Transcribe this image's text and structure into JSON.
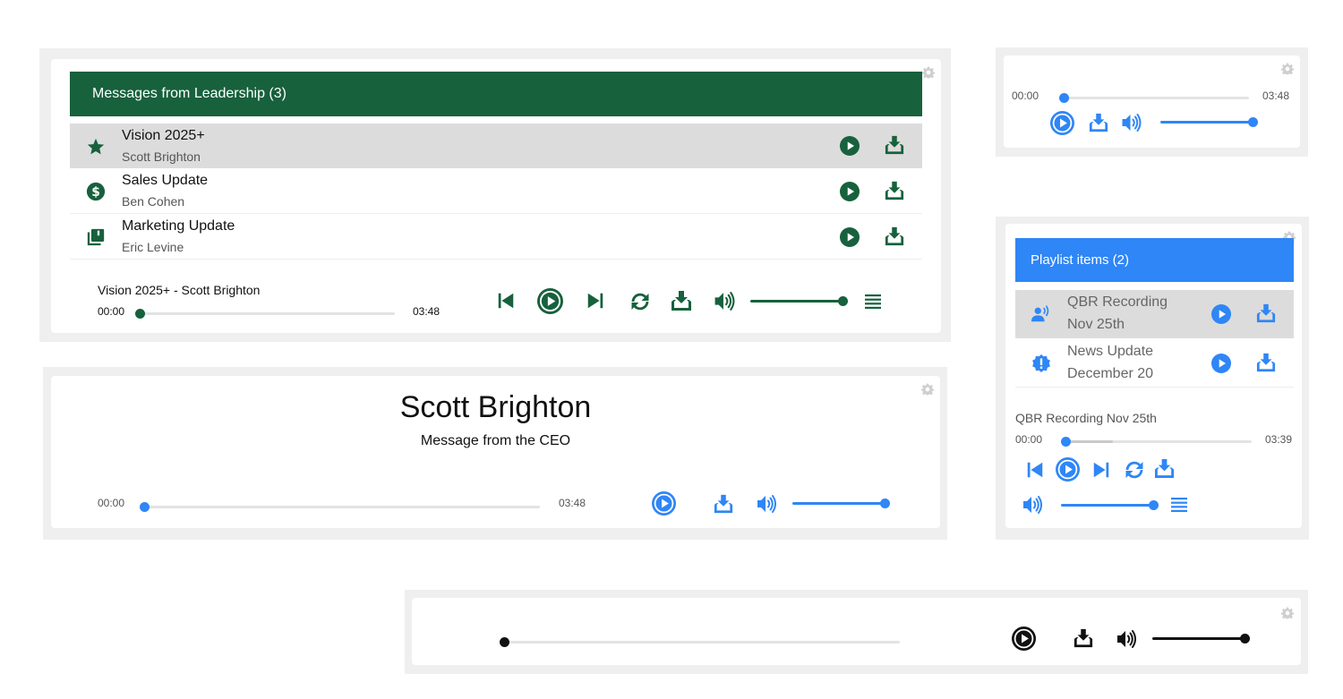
{
  "colors": {
    "green": "#17613d",
    "blue": "#2f86f6",
    "black": "#111111",
    "frame": "#efefef"
  },
  "leadership_player": {
    "header": "Messages from Leadership (3)",
    "items": [
      {
        "title": "Vision 2025+",
        "author": "Scott Brighton",
        "icon": "star-icon",
        "selected": true
      },
      {
        "title": "Sales Update",
        "author": "Ben Cohen",
        "icon": "dollar-icon",
        "selected": false
      },
      {
        "title": "Marketing Update",
        "author": "Eric Levine",
        "icon": "library-icon",
        "selected": false
      }
    ],
    "now_playing": "Vision 2025+ - Scott Brighton",
    "time_current": "00:00",
    "time_total": "03:48",
    "progress": 0,
    "volume": 1.0
  },
  "compact_player": {
    "time_current": "00:00",
    "time_total": "03:48",
    "progress": 0,
    "volume": 1.0
  },
  "featured_player": {
    "name": "Scott Brighton",
    "subtitle": "Message from the CEO",
    "time_current": "00:00",
    "time_total": "03:48",
    "progress": 0,
    "volume": 1.0
  },
  "playlist_player": {
    "header": "Playlist items (2)",
    "items": [
      {
        "title": "QBR Recording",
        "date": "Nov 25th",
        "icon": "voice-icon",
        "selected": true
      },
      {
        "title": "News Update",
        "date": "December 20",
        "icon": "alert-badge-icon",
        "selected": false
      }
    ],
    "now_playing": "QBR Recording Nov 25th",
    "time_current": "00:00",
    "time_total": "03:39",
    "progress": 0,
    "buffered": 0.25,
    "volume": 1.0
  },
  "minimal_player": {
    "progress": 0,
    "volume": 1.0
  }
}
